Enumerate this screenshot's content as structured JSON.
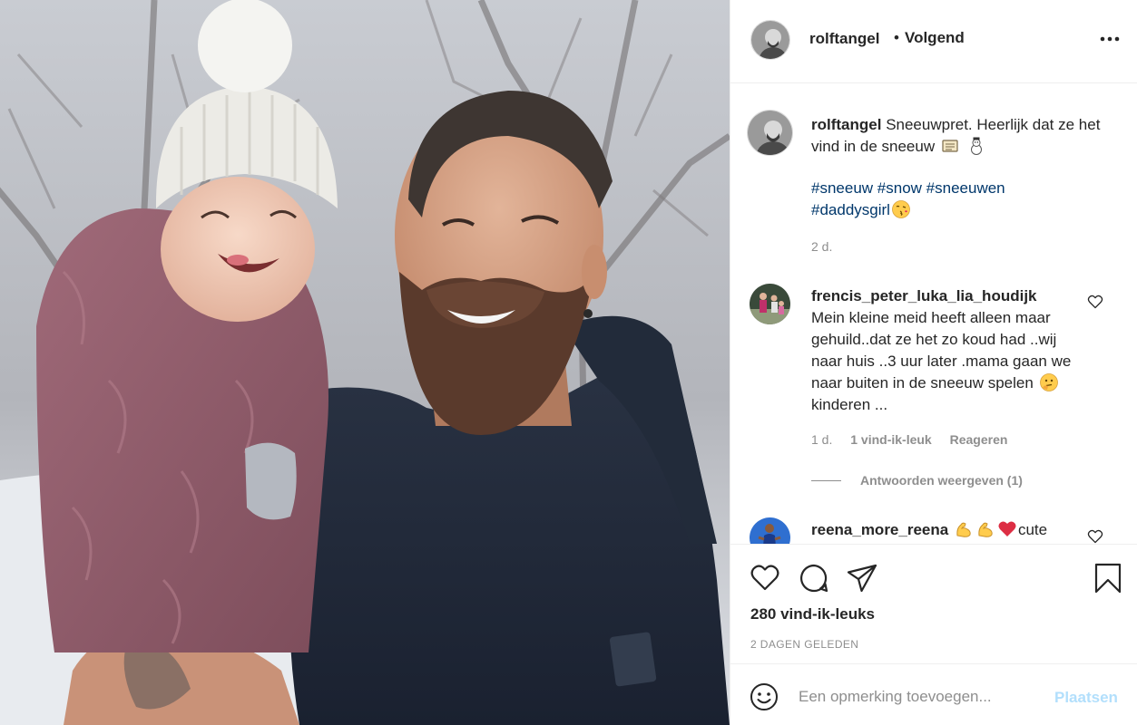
{
  "post": {
    "header": {
      "username": "rolftangel",
      "separator": "•",
      "follow_status": "Volgend"
    },
    "caption": {
      "username": "rolftangel",
      "text": "Sneeuwpret. Heerlijk dat ze het vind in de sneeuw",
      "hashtags": [
        "#sneeuw",
        "#snow",
        "#sneeuwen",
        "#daddysgirl"
      ],
      "time": "2 d."
    },
    "comments": [
      {
        "username": "frencis_peter_luka_lia_houdijk",
        "text_part1": "Mein kleine meid heeft alleen maar gehuild..dat ze het zo koud had ..wij naar huis ..3 uur later .mama gaan we naar buiten in de sneeuw spelen",
        "text_part2": "kinderen ...",
        "time": "1 d.",
        "likes": "1 vind-ik-leuk",
        "reply_label": "Reageren",
        "view_replies": "Antwoorden weergeven (1)"
      },
      {
        "username": "reena_more_reena",
        "text": "cute"
      }
    ],
    "likes": "280 vind-ik-leuks",
    "posted_ago": "2 DAGEN GELEDEN",
    "composer": {
      "placeholder": "Een opmerking toevoegen...",
      "post_label": "Plaatsen"
    },
    "colors": {
      "hashtag": "#00376b",
      "muted": "#8e8e8e",
      "post_button_disabled": "#b2dffc",
      "text": "#262626"
    },
    "icons": [
      "more-options-icon",
      "heart-icon",
      "comment-icon",
      "share-icon",
      "bookmark-icon",
      "emoji-icon",
      "scroll-emoji-icon",
      "snowman-emoji-icon",
      "kiss-emoji-icon",
      "thinking-emoji-icon",
      "flexed-biceps-emoji-icon",
      "red-heart-emoji-icon"
    ]
  }
}
